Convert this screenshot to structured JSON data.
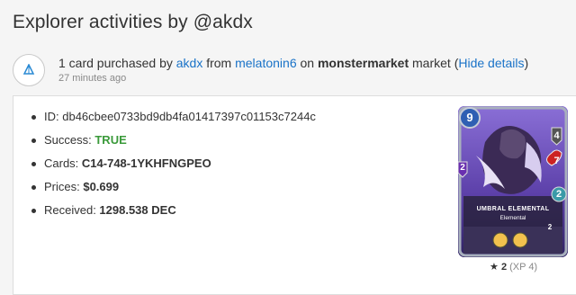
{
  "page": {
    "title": "Explorer activities by @akdx"
  },
  "activity": {
    "icon": "diamond-icon",
    "prefix": "1 card purchased by ",
    "buyer": "akdx",
    "from_text": " from ",
    "seller": "melatonin6",
    "on_text": " on ",
    "market": "monstermarket",
    "market_suffix": " market (",
    "toggle_label": "Hide details",
    "close_paren": ")",
    "time": "27 minutes ago"
  },
  "details": {
    "id_label": "ID: ",
    "id_value": "db46cbee0733bd9db4fa01417397c01153c7244c",
    "success_label": "Success: ",
    "success_value": "TRUE",
    "cards_label": "Cards: ",
    "cards_value": "C14-748-1YKHFNGPEO",
    "prices_label": "Prices: ",
    "prices_value": "$0.699",
    "received_label": "Received: ",
    "received_value": "1298.538 DEC"
  },
  "card": {
    "name": "UMBRAL ELEMENTAL",
    "type": "Elemental",
    "mana": "9",
    "attack": "4",
    "health": "7",
    "magic": "2",
    "speed": "2",
    "level_small": "2",
    "level": "2",
    "xp": "(XP 4)",
    "frame_color": "#6a52b8",
    "star_icon": "star-icon"
  },
  "colors": {
    "link": "#1a73c8",
    "success": "#3a9a3a"
  }
}
